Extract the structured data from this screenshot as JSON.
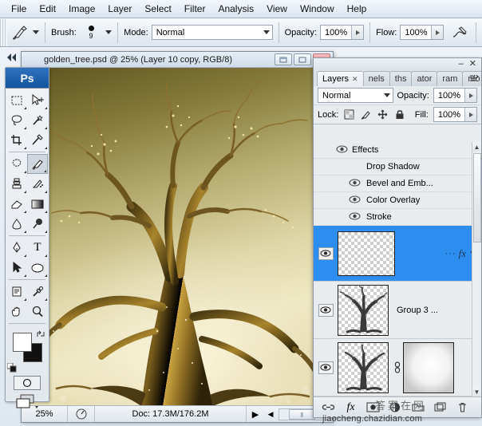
{
  "app": {
    "name": "Adobe Photoshop",
    "badge": "Ps"
  },
  "menubar": {
    "items": [
      {
        "label": "File"
      },
      {
        "label": "Edit"
      },
      {
        "label": "Image"
      },
      {
        "label": "Layer"
      },
      {
        "label": "Select"
      },
      {
        "label": "Filter"
      },
      {
        "label": "Analysis"
      },
      {
        "label": "View"
      },
      {
        "label": "Window"
      },
      {
        "label": "Help"
      }
    ]
  },
  "options_bar": {
    "tool_icon": "brush-tool-icon",
    "brush_label": "Brush:",
    "brush_size": "9",
    "mode_label": "Mode:",
    "mode_value": "Normal",
    "opacity_label": "Opacity:",
    "opacity_value": "100%",
    "flow_label": "Flow:",
    "flow_value": "100%",
    "airbrush_icon": "airbrush-icon"
  },
  "toolbox": {
    "tools": [
      {
        "name": "rectangular-marquee-tool",
        "glyph": "⬚"
      },
      {
        "name": "move-tool",
        "glyph": "➤"
      },
      {
        "name": "lasso-tool",
        "glyph": "⟿"
      },
      {
        "name": "magic-wand-tool",
        "glyph": "✦"
      },
      {
        "name": "crop-tool",
        "glyph": "⌒"
      },
      {
        "name": "slice-tool",
        "glyph": "✂"
      },
      {
        "name": "healing-brush-tool",
        "glyph": "❁"
      },
      {
        "name": "brush-tool",
        "glyph": "✎"
      },
      {
        "name": "clone-stamp-tool",
        "glyph": "⚑"
      },
      {
        "name": "history-brush-tool",
        "glyph": "✐"
      },
      {
        "name": "eraser-tool",
        "glyph": "◰"
      },
      {
        "name": "gradient-tool",
        "glyph": "▤"
      },
      {
        "name": "blur-tool",
        "glyph": "◖"
      },
      {
        "name": "dodge-tool",
        "glyph": "●"
      },
      {
        "name": "pen-tool",
        "glyph": "✒"
      },
      {
        "name": "type-tool",
        "glyph": "T"
      },
      {
        "name": "path-selection-tool",
        "glyph": "➤"
      },
      {
        "name": "ellipse-shape-tool",
        "glyph": "⬭"
      },
      {
        "name": "notes-tool",
        "glyph": "☷"
      },
      {
        "name": "eyedropper-tool",
        "glyph": "⚗"
      },
      {
        "name": "hand-tool",
        "glyph": "✋"
      },
      {
        "name": "zoom-tool",
        "glyph": "⚲"
      }
    ],
    "foreground_color": "#ffffff",
    "background_color": "#111111",
    "swap_icon": "swap-colors-icon",
    "default_colors_icon": "default-colors-icon",
    "quick_mask_icon": "quick-mask-icon",
    "screen_mode_icon": "screen-mode-icon"
  },
  "document": {
    "title": "golden_tree.psd @ 25% (Layer 10 copy, RGB/8)",
    "window_buttons": [
      {
        "name": "minimize-button",
        "glyph": "–"
      },
      {
        "name": "maximize-button",
        "glyph": "□"
      },
      {
        "name": "close-button",
        "glyph": "✕"
      }
    ]
  },
  "statusbar": {
    "zoom": "25%",
    "arrow_icon": "status-arrow-icon",
    "doc_info": "Doc: 17.3M/176.2M",
    "play_icon": "▶",
    "left_arrow": "◀",
    "grip": "⦀"
  },
  "layers_panel": {
    "window_min": "–",
    "window_close": "✕",
    "tabs": [
      {
        "label": "Layers",
        "closable": true,
        "active": true,
        "name": "tab-layers"
      },
      {
        "label": "nels",
        "closable": false,
        "active": false,
        "name": "tab-channels"
      },
      {
        "label": "ths",
        "closable": false,
        "active": false,
        "name": "tab-paths"
      },
      {
        "label": "ator",
        "closable": false,
        "active": false,
        "name": "tab-navigator"
      },
      {
        "label": "ram",
        "closable": false,
        "active": false,
        "name": "tab-histogram"
      },
      {
        "label": "nfo",
        "closable": false,
        "active": false,
        "name": "tab-info"
      }
    ],
    "tab_close_glyph": "✕",
    "panel_menu_glyph": "≡",
    "blend_mode": "Normal",
    "opacity_label": "Opacity:",
    "opacity_value": "100%",
    "lock_label": "Lock:",
    "fill_label": "Fill:",
    "fill_value": "100%",
    "lock_icons": [
      {
        "name": "lock-transparent-pixels-icon"
      },
      {
        "name": "lock-image-pixels-icon"
      },
      {
        "name": "lock-position-icon"
      },
      {
        "name": "lock-all-icon"
      }
    ],
    "effects": [
      {
        "label": "Effects",
        "has_eye": true,
        "indent": false,
        "name": "layer-effect-effects"
      },
      {
        "label": "Drop Shadow",
        "has_eye": false,
        "indent": true,
        "name": "layer-effect-drop-shadow"
      },
      {
        "label": "Bevel and Emb...",
        "has_eye": true,
        "indent": true,
        "name": "layer-effect-bevel-emboss"
      },
      {
        "label": "Color Overlay",
        "has_eye": true,
        "indent": true,
        "name": "layer-effect-color-overlay"
      },
      {
        "label": "Stroke",
        "has_eye": true,
        "indent": true,
        "name": "layer-effect-stroke"
      }
    ],
    "layers": [
      {
        "name_label": "",
        "selected": true,
        "thumb": "empty",
        "has_fx": true,
        "fx_dots": "···",
        "fx_glyph": "fx",
        "has_mask": false
      },
      {
        "name_label": "Group 3 ...",
        "selected": false,
        "thumb": "tree",
        "has_fx": false,
        "fx_dots": "",
        "fx_glyph": "",
        "has_mask": false
      },
      {
        "name_label": "",
        "selected": false,
        "thumb": "tree",
        "has_fx": false,
        "fx_dots": "",
        "fx_glyph": "",
        "has_mask": true
      }
    ],
    "bottom_buttons": [
      {
        "name": "link-layers-button",
        "glyph": "∞"
      },
      {
        "name": "add-layer-style-button",
        "glyph": "fx"
      },
      {
        "name": "add-layer-mask-button",
        "glyph": "□"
      },
      {
        "name": "new-adjustment-layer-button",
        "glyph": "◑"
      },
      {
        "name": "new-group-button",
        "glyph": "▭"
      },
      {
        "name": "new-layer-button",
        "glyph": "⧉"
      },
      {
        "name": "delete-layer-button",
        "glyph": "Ὕ1"
      }
    ]
  },
  "watermark": {
    "text": "jiaocheng.chazidian.com",
    "cn_text": "答案在网"
  },
  "colors": {
    "selection_blue": "#2e8ef0",
    "panel_bg": "#e9ecef",
    "chrome_light": "#f2f5f8"
  }
}
